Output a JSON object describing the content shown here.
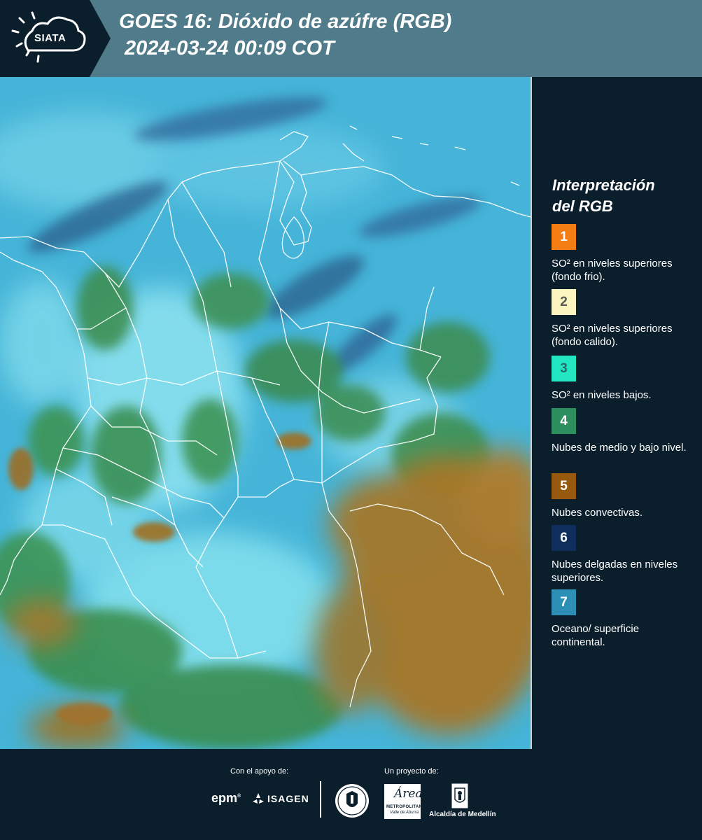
{
  "header": {
    "logo_text": "SIATA",
    "title_line1": "GOES 16: Dióxido de azúfre (RGB)",
    "title_line2": "2024-03-24 00:09 COT"
  },
  "legend": {
    "title_line1": "Interpretación",
    "title_line2": "del RGB",
    "items": [
      {
        "number": "1",
        "color": "#f47e13",
        "number_color": "#ffffff",
        "text": "SO² en niveles superiores (fondo frio)."
      },
      {
        "number": "2",
        "color": "#fbf5c0",
        "number_color": "#5a5a5a",
        "text": "SO² en niveles superiores (fondo calido)."
      },
      {
        "number": "3",
        "color": "#23e7c2",
        "number_color": "#2a6a6a",
        "text": "SO² en niveles bajos."
      },
      {
        "number": "4",
        "color": "#2e8f5e",
        "number_color": "#ffffff",
        "text": "Nubes de medio y bajo nivel."
      },
      {
        "number": "5",
        "color": "#96590e",
        "number_color": "#ffffff",
        "text": "Nubes convectivas."
      },
      {
        "number": "6",
        "color": "#0f2e5c",
        "number_color": "#ffffff",
        "text": "Nubes delgadas en niveles superiores."
      },
      {
        "number": "7",
        "color": "#2e8fb6",
        "number_color": "#ffffff",
        "text": "Oceano/ superficie continental."
      }
    ]
  },
  "footer": {
    "support_label": "Con el apoyo de:",
    "project_label": "Un proyecto de:",
    "epm_logo": "epm",
    "isagen_logo": "ISAGEN",
    "area_logo_word": "Área",
    "area_logo_line1": "METROPOLITANA",
    "area_logo_line2": "Valle de Aburrá",
    "alcaldia_label": "Alcaldía de Medellín"
  },
  "map_colors": {
    "ocean_surface": "#45b4d8",
    "low_so2": "#7fe0ee",
    "mid_low_clouds": "#3c8f52",
    "convective": "#a87626",
    "thin_high_clouds": "#2b5f8a",
    "borders": "#ffffff"
  }
}
